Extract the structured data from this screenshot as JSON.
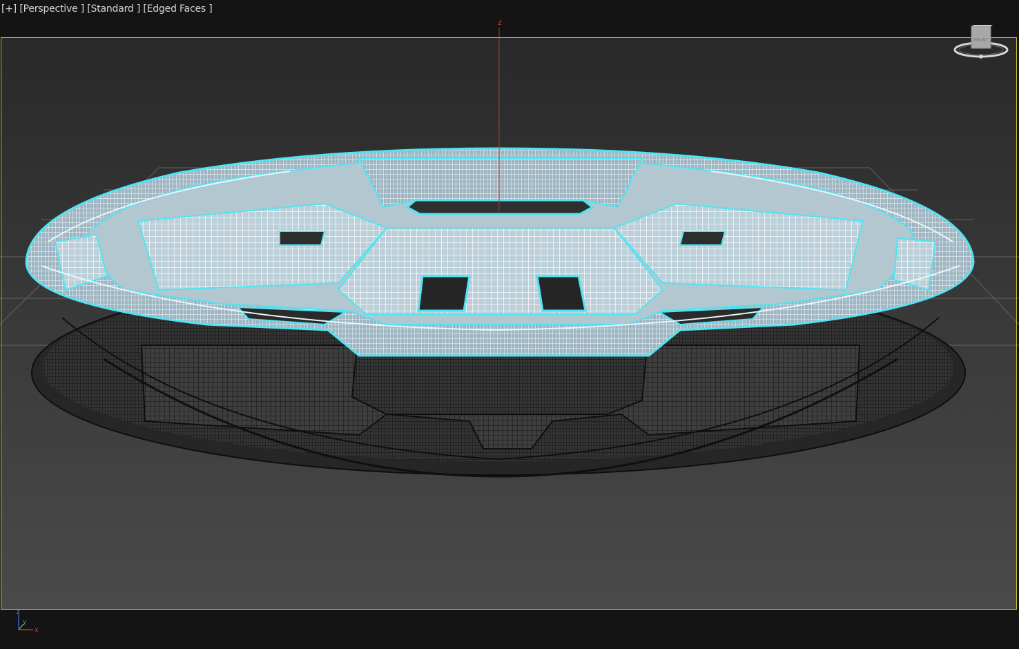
{
  "viewport": {
    "labels": {
      "plus": "[+]",
      "view": "[Perspective ]",
      "shading": "[Standard ]",
      "display": "[Edged Faces ]"
    },
    "axis_label_z": "z",
    "viewcube": {
      "face_label": "FRONT"
    },
    "tripod": {
      "x": "x",
      "y": "y",
      "z": "z"
    },
    "colors": {
      "background_top": "#2a2a2a",
      "background_bottom": "#474747",
      "selection_frame": "#c8c23a",
      "selected_wire": "#e8f6fb",
      "selected_outline": "#4fe4f2",
      "unselected_wire": "#1e1e1e",
      "z_axis": "#c03030"
    }
  }
}
